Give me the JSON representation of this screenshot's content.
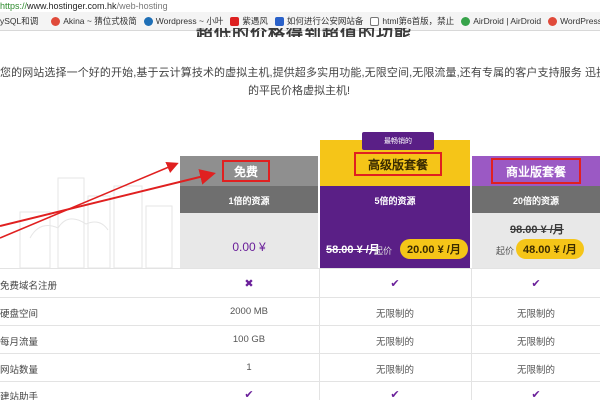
{
  "browser": {
    "url_protocol": "https://",
    "url_host": "www.hostinger.com.hk",
    "url_path": "/web-hosting",
    "bookmarks": [
      {
        "label": "ySQL和调",
        "color": "#ffffff"
      },
      {
        "label": "Akina ~ 猜位式极简",
        "color": "#e04a3a"
      },
      {
        "label": "Wordpress ~ 小叶",
        "color": "#1e6fb6"
      },
      {
        "label": "紫遇风",
        "color": "#d22"
      },
      {
        "label": "如何进行公安网站备",
        "color": "#2a61c9"
      },
      {
        "label": "html第6首版，禁止",
        "color": "#555"
      },
      {
        "label": "AirDroid | AirDroid",
        "color": "#37a34a"
      },
      {
        "label": "WordPress插式图",
        "color": "#e04a3a"
      }
    ]
  },
  "hero": {
    "heading": "超低的价格得到超值的功能",
    "intro_line1": "您的网站选择一个好的开始,基于云计算技术的虚拟主机,提供超多实用功能,无限空间,无限流量,还有专属的客户支持服务 迅捷,可靠且安全",
    "intro_line2": "的平民价格虚拟主机!"
  },
  "plans": {
    "free": {
      "name": "免费",
      "resources": "1倍的资源",
      "price": "0.00 ¥"
    },
    "advanced": {
      "badge": "最畅销的",
      "name": "高级版套餐",
      "resources": "5倍的资源",
      "old_price": "58.00 ¥ /月",
      "from_label": "起价",
      "price": "20.00 ¥ /月"
    },
    "business": {
      "name": "商业版套餐",
      "resources": "20倍的资源",
      "old_price": "98.00 ¥ /月",
      "from_label": "起价",
      "price": "48.00 ¥ /月"
    }
  },
  "features": [
    {
      "label": "免费域名注册",
      "free": "✖",
      "advanced": "✔",
      "business": "✔"
    },
    {
      "label": "硬盘空间",
      "free": "2000 MB",
      "advanced": "无限制的",
      "business": "无限制的"
    },
    {
      "label": "每月流量",
      "free": "100 GB",
      "advanced": "无限制的",
      "business": "无限制的"
    },
    {
      "label": "网站数量",
      "free": "1",
      "advanced": "无限制的",
      "business": "无限制的"
    },
    {
      "label": "建站助手",
      "free": "✔",
      "advanced": "✔",
      "business": "✔"
    }
  ],
  "colors": {
    "purple": "#5a1f86",
    "yellow": "#f5c518",
    "annotation_red": "#e02020",
    "gray_header": "#8f8f8f"
  }
}
